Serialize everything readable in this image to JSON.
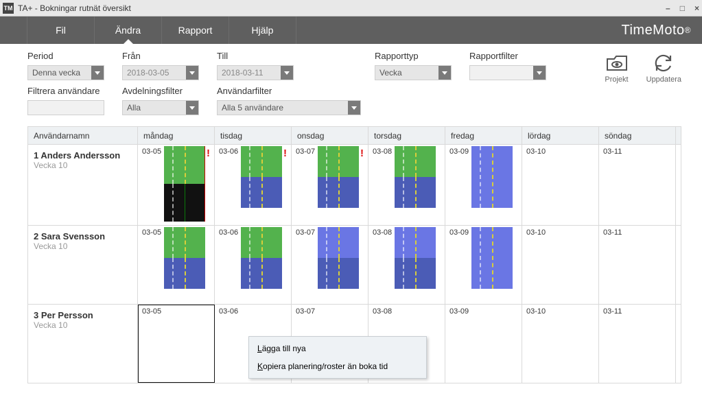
{
  "window": {
    "title": "TA+ - Bokningar rutnät översikt"
  },
  "menu": {
    "file": "Fil",
    "edit": "Ändra",
    "report": "Rapport",
    "help": "Hjälp"
  },
  "brand": "TimeMoto",
  "filters": {
    "period_label": "Period",
    "period_value": "Denna vecka",
    "from_label": "Från",
    "from_value": "2018-03-05",
    "to_label": "Till",
    "to_value": "2018-03-11",
    "reporttype_label": "Rapporttyp",
    "reporttype_value": "Vecka",
    "reportfilter_label": "Rapportfilter",
    "reportfilter_value": "",
    "filterusers_label": "Filtrera användare",
    "filterusers_value": "",
    "deptfilter_label": "Avdelningsfilter",
    "deptfilter_value": "Alla",
    "userfilter_label": "Användarfilter",
    "userfilter_value": "Alla 5 användare"
  },
  "tools": {
    "project": "Projekt",
    "refresh": "Uppdatera"
  },
  "grid": {
    "col_user": "Användarnamn",
    "days": [
      {
        "name": "måndag",
        "date": "03-05"
      },
      {
        "name": "tisdag",
        "date": "03-06"
      },
      {
        "name": "onsdag",
        "date": "03-07"
      },
      {
        "name": "torsdag",
        "date": "03-08"
      },
      {
        "name": "fredag",
        "date": "03-09"
      },
      {
        "name": "lördag",
        "date": "03-10"
      },
      {
        "name": "söndag",
        "date": "03-11"
      }
    ],
    "week_label": "Vecka 10",
    "users": [
      {
        "name": "1 Anders Andersson"
      },
      {
        "name": "2 Sara Svensson"
      },
      {
        "name": "3 Per Persson"
      }
    ]
  },
  "context_menu": {
    "add": "Lägga till nya",
    "copy": "Kopiera planering/roster än boka tid"
  }
}
